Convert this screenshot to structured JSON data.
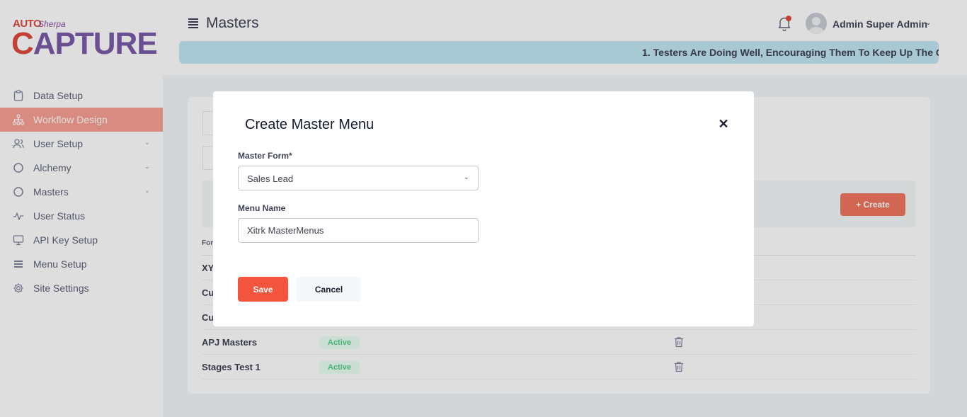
{
  "logo": {
    "auto": "AUTO",
    "sherpa": "Sherpa",
    "capture_c": "C",
    "capture_rest": "APTURE"
  },
  "sidebar": {
    "items": [
      {
        "label": "Data Setup",
        "icon": "clipboard-icon"
      },
      {
        "label": "Workflow Design",
        "icon": "sitemap-icon",
        "active": true
      },
      {
        "label": "User Setup",
        "icon": "users-icon",
        "expandable": true
      },
      {
        "label": "Alchemy",
        "icon": "circle-icon",
        "expandable": true
      },
      {
        "label": "Masters",
        "icon": "circle-icon",
        "expandable": true
      },
      {
        "label": "User Status",
        "icon": "pulse-icon"
      },
      {
        "label": "API Key Setup",
        "icon": "monitor-icon"
      },
      {
        "label": "Menu Setup",
        "icon": "list-icon"
      },
      {
        "label": "Site Settings",
        "icon": "gear-icon"
      }
    ]
  },
  "header": {
    "title": "Masters",
    "user_name": "Admin Super Admin",
    "marquee": "1. Testers Are Doing Well, Encouraging Them To Keep Up The G"
  },
  "content": {
    "create_label": "+ Create",
    "column_header": "For",
    "rows": [
      {
        "name": "XY",
        "status": ""
      },
      {
        "name": "Cu",
        "status": ""
      },
      {
        "name": "Cu",
        "status": ""
      },
      {
        "name": "APJ Masters",
        "status": "Active"
      },
      {
        "name": "Stages Test 1",
        "status": "Active"
      }
    ]
  },
  "modal": {
    "title": "Create Master Menu",
    "master_form_label": "Master Form*",
    "master_form_value": "Sales Lead",
    "menu_name_label": "Menu Name",
    "menu_name_value": "Xitrk MasterMenus",
    "save_label": "Save",
    "cancel_label": "Cancel"
  },
  "colors": {
    "accent": "#f2543d",
    "active_nav": "#f8a195",
    "badge_text": "#50cd89",
    "marquee_bg": "#c2e6f3"
  }
}
